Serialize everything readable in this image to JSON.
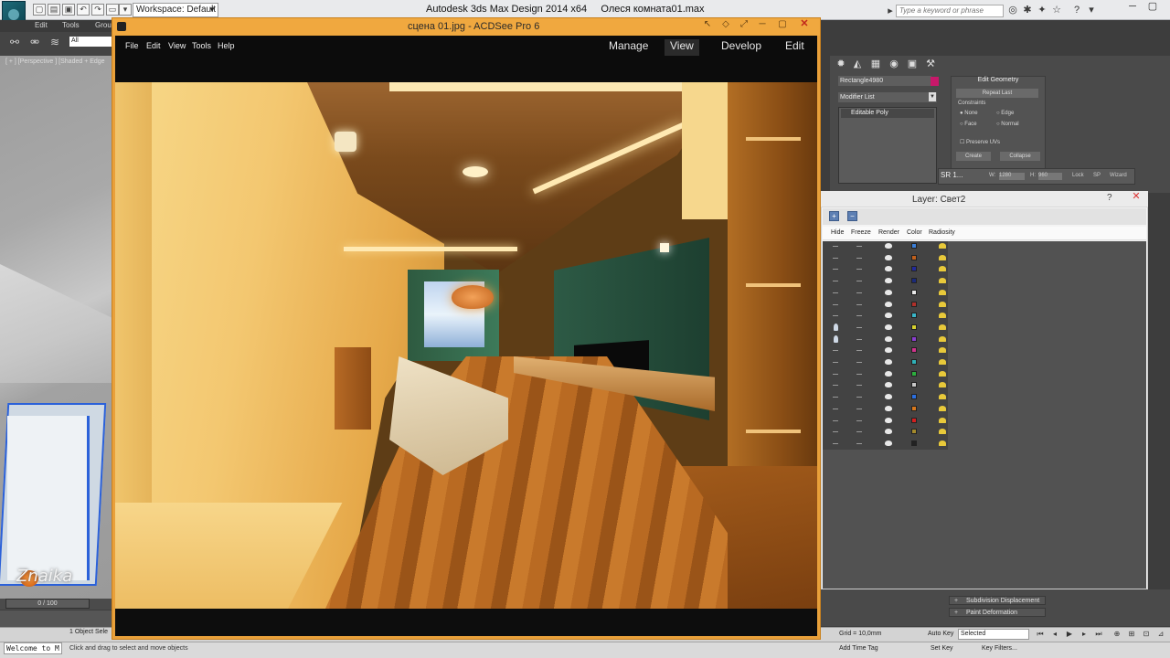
{
  "max": {
    "title": "Autodesk 3ds Max Design 2014 x64     Олеся комната01.max",
    "workspace": "Workspace: Default",
    "search_placeholder": "Type a keyword or phrase",
    "menus": [
      "Edit",
      "Tools",
      "Grou"
    ],
    "selection_filter": "All",
    "viewport_label": "[ + ] [Perspective ] [Shaded + Edge",
    "timeline": "0 / 100",
    "welcome": "Welcome to M",
    "objects_selected": "1 Object Sele",
    "status_text": "Click and drag to select and move objects",
    "grid": "Grid = 10,0mm",
    "add_time_tag": "Add Time Tag",
    "auto_key": "Auto Key",
    "set_key": "Set Key",
    "key_mode": "Selected",
    "key_filters": "Key Filters..."
  },
  "watermark": "Znaika",
  "command_panel": {
    "object_name": "Rectangle4980",
    "object_color": "#c8186a",
    "modifier_list": "Modifier List",
    "stack_item": "Editable Poly",
    "edit_geometry": "Edit Geometry",
    "repeat_last": "Repeat Last",
    "constraints": "Constraints",
    "constraint_none": "None",
    "constraint_edge": "Edge",
    "constraint_face": "Face",
    "constraint_normal": "Normal",
    "preserve_uvs": "Preserve UVs",
    "create": "Create",
    "collapse": "Collapse",
    "rollouts": [
      "Subdivision Displacement",
      "Paint Deformation"
    ]
  },
  "sr_widget": {
    "label": "SR 1...",
    "w_label": "W:",
    "w_value": "1280",
    "h_label": "H:",
    "h_value": "960",
    "lock": "Lock",
    "sp": "SP",
    "wizard": "Wizard"
  },
  "layer_dialog": {
    "title": "Layer: Свет2",
    "help": "?",
    "columns": [
      "Hide",
      "Freeze",
      "Render",
      "Color",
      "Radiosity"
    ],
    "row_colors": [
      "#3b7fd8",
      "#c1601c",
      "#232b9b",
      "#1a2a7a",
      "#e9e9e9",
      "#b0302a",
      "#39b7c9",
      "#d8d22e",
      "#8a3ed0",
      "#d0338c",
      "#2fb0b7",
      "#2cae3e",
      "#c8c8c8",
      "#2b6fe0",
      "#d8781c",
      "#d41f1f",
      "#a48a2c",
      "#222222"
    ],
    "bulb_rows": [
      7,
      8
    ]
  },
  "acdsee": {
    "title": "сцена 01.jpg - ACDSee Pro 6",
    "menus": [
      "File",
      "Edit",
      "View",
      "Tools",
      "Help"
    ],
    "modes": [
      "Manage",
      "View",
      "Develop",
      "Edit"
    ],
    "active_mode": "View"
  }
}
